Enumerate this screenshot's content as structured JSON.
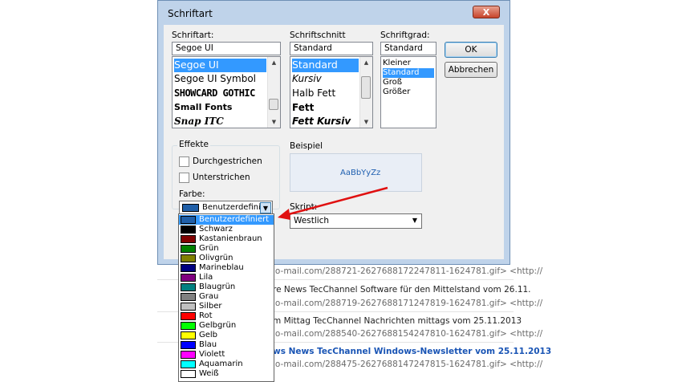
{
  "background": {
    "lines": [
      {
        "kind": "url",
        "text": "io-mail.com/288721-2627688172247811-1624781.gif>  <http://"
      },
      {
        "kind": "subj",
        "text": "re News  TecChannel Software für den Mittelstand vom 26.11."
      },
      {
        "kind": "url",
        "text": "io-mail.com/288719-2627688171247819-1624781.gif>  <http://"
      },
      {
        "kind": "subj",
        "text": "m Mittag  TecChannel Nachrichten mittags vom 25.11.2013"
      },
      {
        "kind": "url",
        "text": "io-mail.com/288540-2627688154247810-1624781.gif>  <http://"
      },
      {
        "kind": "subj-blue",
        "text": "ws News  TecChannel Windows-Newsletter vom 25.11.2013"
      },
      {
        "kind": "url",
        "text": "io-mail.com/288475-2627688147247815-1624781.gif>  <http://"
      }
    ]
  },
  "dialog": {
    "title": "Schriftart",
    "close_label": "X",
    "font": {
      "label": "Schriftart:",
      "value": "Segoe UI",
      "items": [
        "Segoe UI",
        "Segoe UI Symbol",
        "SHOWCARD GOTHIC",
        "Small Fonts",
        "Snap ITC"
      ]
    },
    "style": {
      "label": "Schriftschnitt",
      "value": "Standard",
      "items": [
        "Standard",
        "Kursiv",
        "Halb Fett",
        "Fett",
        "Fett Kursiv"
      ]
    },
    "size": {
      "label": "Schriftgrad:",
      "value": "Standard",
      "items": [
        "Kleiner",
        "Standard",
        "Groß",
        "Größer"
      ]
    },
    "ok_label": "OK",
    "cancel_label": "Abbrechen",
    "effects": {
      "label": "Effekte",
      "strike_label": "Durchgestrichen",
      "underline_label": "Unterstrichen"
    },
    "color": {
      "label": "Farbe:",
      "value": "Benutzerdefinie",
      "value_color": "#1f5fa8"
    },
    "sample": {
      "label": "Beispiel",
      "text": "AaBbYyZz"
    },
    "script": {
      "label": "Skript:",
      "value": "Westlich"
    }
  },
  "color_dropdown": {
    "items": [
      {
        "label": "Benutzerdefiniert",
        "color": "#1f5fa8",
        "selected": true
      },
      {
        "label": "Schwarz",
        "color": "#000000"
      },
      {
        "label": "Kastanienbraun",
        "color": "#800000"
      },
      {
        "label": "Grün",
        "color": "#008000"
      },
      {
        "label": "Olivgrün",
        "color": "#808000"
      },
      {
        "label": "Marineblau",
        "color": "#000080"
      },
      {
        "label": "Lila",
        "color": "#800080"
      },
      {
        "label": "Blaugrün",
        "color": "#008080"
      },
      {
        "label": "Grau",
        "color": "#808080"
      },
      {
        "label": "Silber",
        "color": "#c0c0c0"
      },
      {
        "label": "Rot",
        "color": "#ff0000"
      },
      {
        "label": "Gelbgrün",
        "color": "#00ff00"
      },
      {
        "label": "Gelb",
        "color": "#ffff00"
      },
      {
        "label": "Blau",
        "color": "#0000ff"
      },
      {
        "label": "Violett",
        "color": "#ff00ff"
      },
      {
        "label": "Aquamarin",
        "color": "#00ffff"
      },
      {
        "label": "Weiß",
        "color": "#ffffff"
      }
    ]
  },
  "annotation_arrow_color": "#e01010"
}
